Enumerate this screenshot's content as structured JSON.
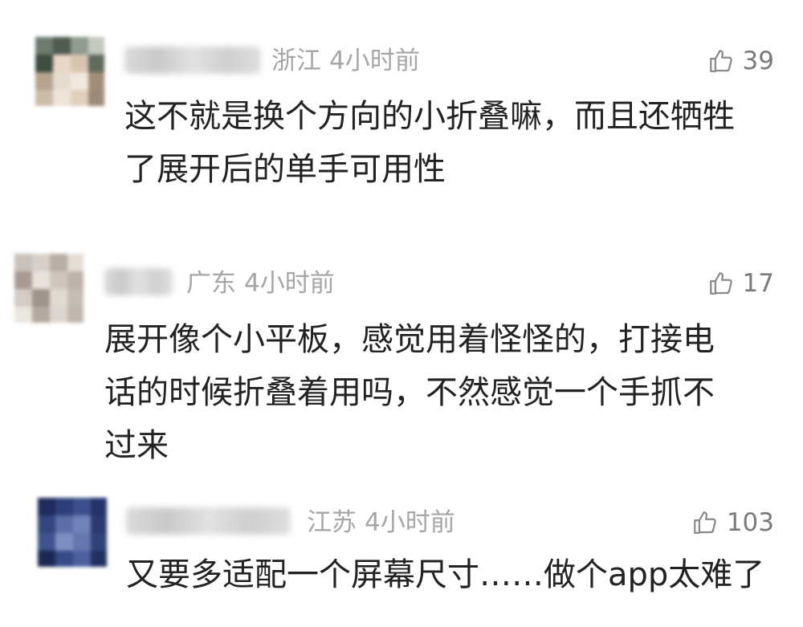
{
  "comments": [
    {
      "location": "浙江",
      "time": "4小时前",
      "likes": "39",
      "text_lines": [
        "这不就是换个方向的小折叠嘛，而且还牺牲",
        "了展开后的单手可用性"
      ],
      "avatar_colors": [
        "#6d7c6f",
        "#4f5a50",
        "#8f9c8e",
        "#c4c9bf",
        "#3f4c41",
        "#e8d6c6",
        "#d9c4b0",
        "#5f6b5c",
        "#b7a38f",
        "#e5dccf",
        "#f1e8df",
        "#a48d78",
        "#cdbba9",
        "#efe3d8",
        "#e0cfbd",
        "#9c8a77"
      ]
    },
    {
      "location": "广东",
      "time": "4小时前",
      "likes": "17",
      "text_lines": [
        "展开像个小平板，感觉用着怪怪的，打接电",
        "话的时候折叠着用吗，不然感觉一个手抓不",
        "过来"
      ],
      "avatar_colors": [
        "#c9c1ba",
        "#d8d0c8",
        "#b9aea5",
        "#e4ddd6",
        "#a79b91",
        "#e9e3dc",
        "#cfc6be",
        "#bdb3aa",
        "#d4ccc5",
        "#9f948b",
        "#e1dad3",
        "#c5bcb4",
        "#ece6e0",
        "#b3a9a0",
        "#ddd5ce",
        "#c0b7ae"
      ]
    },
    {
      "location": "江苏",
      "time": "4小时前",
      "likes": "103",
      "text_lines": [
        "又要多适配一个屏幕尺寸……做个app太难了"
      ],
      "avatar_colors": [
        "#1f2c5c",
        "#2d3f7a",
        "#3b4f8c",
        "#25336a",
        "#33467f",
        "#5a6fa8",
        "#6f83b9",
        "#2a3a70",
        "#3f5391",
        "#7d8fc2",
        "#6477ae",
        "#2f4279",
        "#1c2854",
        "#364a86",
        "#4c60a0",
        "#22305f"
      ]
    }
  ]
}
